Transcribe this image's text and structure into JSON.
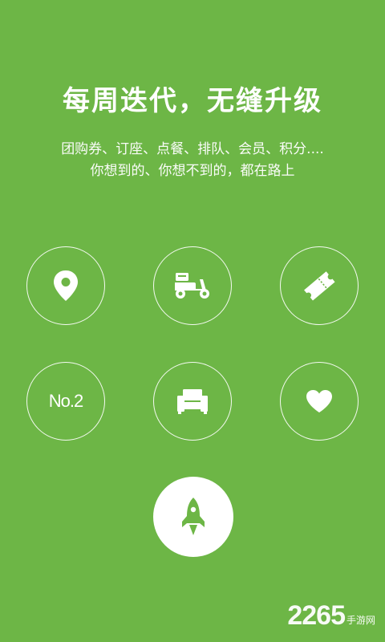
{
  "headline": "每周迭代，无缝升级",
  "subtitle": {
    "line1": "团购券、订座、点餐、排队、会员、积分....",
    "line2": "你想到的、你想不到的，都在路上"
  },
  "features": [
    {
      "icon": "location-pin-icon"
    },
    {
      "icon": "delivery-scooter-icon"
    },
    {
      "icon": "ticket-icon"
    },
    {
      "icon": "queue-number-icon",
      "label": "No.2"
    },
    {
      "icon": "sofa-seat-icon"
    },
    {
      "icon": "heart-icon"
    }
  ],
  "action": {
    "icon": "rocket-icon"
  },
  "watermark": {
    "number": "2265",
    "text": "手游网"
  },
  "colors": {
    "background": "#6db646",
    "foreground": "#ffffff"
  }
}
